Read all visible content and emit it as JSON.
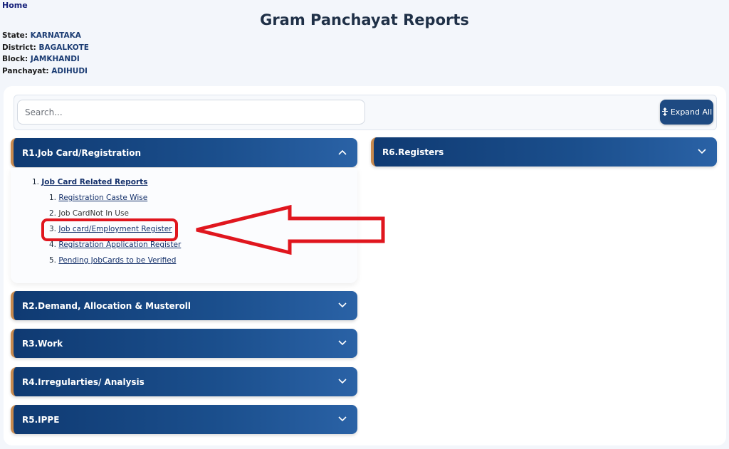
{
  "nav": {
    "home_label": "Home"
  },
  "header": {
    "title": "Gram Panchayat Reports"
  },
  "location": [
    {
      "label": "State:",
      "value": "KARNATAKA"
    },
    {
      "label": "District:",
      "value": "BAGALKOTE"
    },
    {
      "label": "Block:",
      "value": "JAMKHANDI"
    },
    {
      "label": "Panchayat:",
      "value": "ADIHUDI"
    }
  ],
  "search": {
    "placeholder": "Search...",
    "value": ""
  },
  "toolbar": {
    "expand_all_label": "Expand All",
    "expand_icon": "expand-vertical-icon"
  },
  "sections": [
    {
      "label": "R1.Job Card/Registration",
      "expanded": true
    },
    {
      "label": "R2.Demand, Allocation & Musteroll",
      "expanded": false
    },
    {
      "label": "R3.Work",
      "expanded": false
    },
    {
      "label": "R4.Irregularties/ Analysis",
      "expanded": false
    },
    {
      "label": "R5.IPPE",
      "expanded": false
    },
    {
      "label": "R6.Registers",
      "expanded": false
    }
  ],
  "r1_content": {
    "group_number": "1.",
    "group_label": "Job Card Related Reports",
    "items": [
      {
        "number": "1.",
        "label": "Registration Caste Wise",
        "link": true
      },
      {
        "number": "2.",
        "label": "Job CardNot In Use",
        "link": false
      },
      {
        "number": "3.",
        "label": "Job card/Employment Register",
        "link": true
      },
      {
        "number": "4.",
        "label": "Registration Application Register",
        "link": true
      },
      {
        "number": "5.",
        "label": "Pending JobCards to be Verified",
        "link": true
      }
    ]
  },
  "annotation": {
    "color": "#e0161e",
    "highlighted_item": "Job card/Employment Register"
  },
  "colors": {
    "accordion_bg": "#0f3a72",
    "accordion_accent": "#c88a4e",
    "button_bg": "#1e4a82"
  }
}
